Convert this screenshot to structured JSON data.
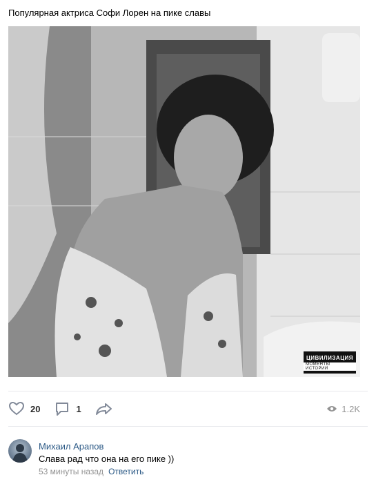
{
  "post": {
    "text": "Популярная актриса Софи Лорен на пике славы",
    "image_alt": "black and white vintage photo",
    "watermark": {
      "line1": "ЦИВИЛИЗАЦИЯ",
      "line2": "МОМЕНТЫ ИСТОРИИ"
    }
  },
  "actions": {
    "like_icon": "heart-icon",
    "likes": "20",
    "comment_icon": "comment-icon",
    "comments": "1",
    "share_icon": "share-icon",
    "views_icon": "eye-icon",
    "views": "1.2K"
  },
  "comment": {
    "author": "Михаил Арапов",
    "text": "Слава рад что она на его пике ))",
    "time": "53 минуты назад",
    "reply_label": "Ответить"
  },
  "colors": {
    "link": "#2a5885",
    "muted": "#828a99",
    "divider": "#e7e8ec"
  }
}
